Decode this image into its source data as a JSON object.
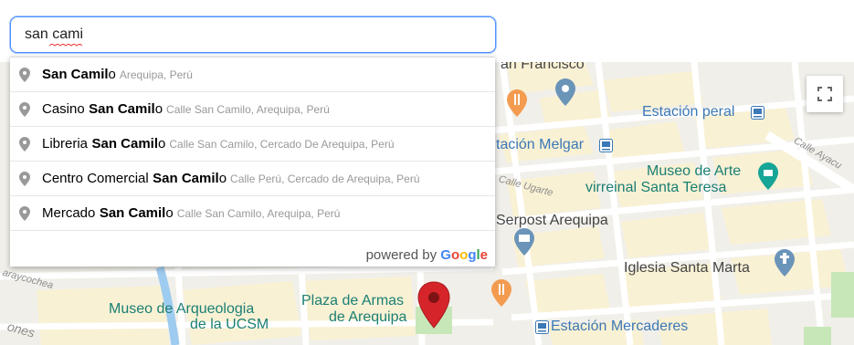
{
  "search": {
    "value": "san cami"
  },
  "suggestions": [
    {
      "prefix": "",
      "match": "San Camil",
      "rest": "o",
      "secondary": "Arequipa, Perú"
    },
    {
      "prefix": "Casino ",
      "match": "San Camil",
      "rest": "o",
      "secondary": "Calle San Camilo, Arequipa, Perú"
    },
    {
      "prefix": "Libreria ",
      "match": "San Camil",
      "rest": "o",
      "secondary": "Calle San Camilo, Cercado De Arequipa, Perú"
    },
    {
      "prefix": "Centro Comercial ",
      "match": "San Camil",
      "rest": "o",
      "secondary": "Calle Perú, Cercado de Arequipa, Perú"
    },
    {
      "prefix": "Mercado ",
      "match": "San Camil",
      "rest": "o",
      "secondary": "Calle San Camilo, Arequipa, Perú"
    }
  ],
  "powered_by": {
    "text": "powered by",
    "g1": "G",
    "g2": "o",
    "g3": "o",
    "g4": "g",
    "g5": "l",
    "g6": "e"
  },
  "map": {
    "san_francisco": "an Francisco",
    "estacion_peral": "Estación peral",
    "estacion_melgar": "tación Melgar",
    "museo_arte_1": "Museo de Arte",
    "museo_arte_2": "virreinal Santa Teresa",
    "calle_ugarte": "Calle Ugarte",
    "calle_ayacucho": "Calle Ayacu",
    "serpost": "Serpost Arequipa",
    "iglesia": "Iglesia Santa Marta",
    "raycochea": "araycochea",
    "museo_arq_1": "Museo de Arqueologia",
    "museo_arq_2": "de la UCSM",
    "plaza_1": "Plaza de Armas",
    "plaza_2": "de Arequipa",
    "estacion_mercaderes": "Estación Mercaderes",
    "ones": "ones"
  },
  "colors": {
    "accent": "#4d90fe",
    "pin": "#d6252a",
    "transit_blue": "#3b78b6",
    "teal": "#1a7f74"
  }
}
